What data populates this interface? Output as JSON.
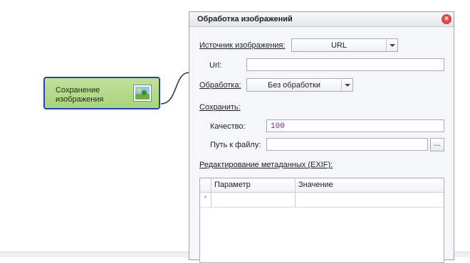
{
  "node": {
    "label": "Сохранение изображения",
    "icon": "image-icon"
  },
  "dialog": {
    "title": "Обработка изображений",
    "close_icon": "close-icon",
    "source": {
      "label": "Источник изображения:",
      "value": "URL"
    },
    "url": {
      "label": "Url:",
      "value": ""
    },
    "processing": {
      "label": "Обработка:",
      "value": "Без обработки"
    },
    "save": {
      "label": "Сохранить:",
      "quality_label": "Качество:",
      "quality_value": "100",
      "path_label": "Путь к файлу:",
      "path_value": "",
      "browse_label": "..."
    },
    "exif": {
      "label": "Редактирование метаданных (EXIF):",
      "columns": [
        "Параметр",
        "Значение"
      ],
      "new_row_marker": "*"
    }
  },
  "colors": {
    "node_fill": "#abd67e",
    "node_border": "#2a3fb8",
    "close": "#d93a3a",
    "quality_text": "#7a2a8c"
  }
}
